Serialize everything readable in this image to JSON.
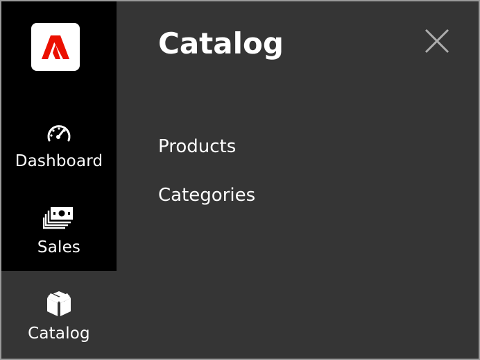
{
  "brand": {
    "logo_icon": "adobe-a-logo",
    "logo_color": "#eb1000"
  },
  "sidebar": {
    "background": "#000000",
    "items": [
      {
        "label": "Dashboard",
        "icon": "speedometer-icon",
        "active": false
      },
      {
        "label": "Sales",
        "icon": "money-stack-icon",
        "active": false
      },
      {
        "label": "Catalog",
        "icon": "box-icon",
        "active": true
      }
    ]
  },
  "submenu": {
    "title": "Catalog",
    "close_icon": "close-icon",
    "background": "#353535",
    "items": [
      {
        "label": "Products"
      },
      {
        "label": "Categories"
      }
    ]
  }
}
